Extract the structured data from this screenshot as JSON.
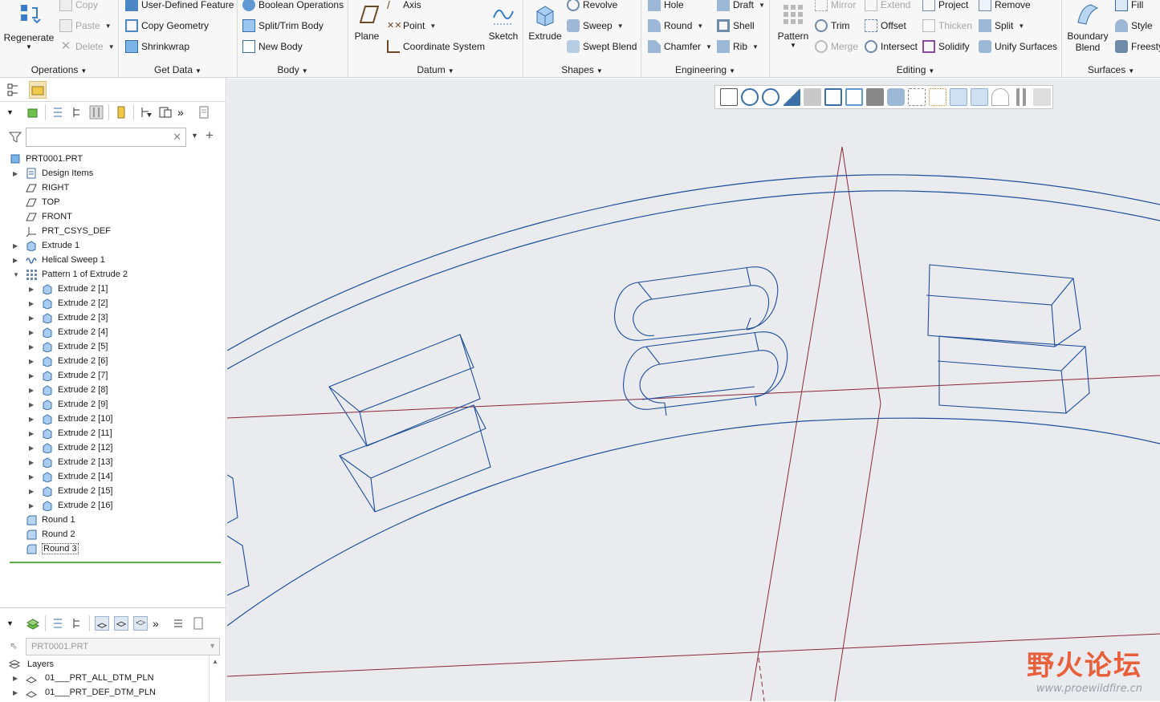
{
  "ribbon": {
    "groups": [
      {
        "title": "Operations"
      },
      {
        "title": "Get Data"
      },
      {
        "title": "Body"
      },
      {
        "title": "Datum"
      },
      {
        "title": "Shapes"
      },
      {
        "title": "Engineering"
      },
      {
        "title": "Editing"
      },
      {
        "title": "Surfaces"
      }
    ],
    "regenerate": "Regenerate",
    "copy": "Copy",
    "paste": "Paste",
    "delete": "Delete",
    "user_defined_feature": "User-Defined Feature",
    "copy_geometry": "Copy Geometry",
    "shrinkwrap": "Shrinkwrap",
    "boolean_operations": "Boolean Operations",
    "split_trim_body": "Split/Trim Body",
    "new_body": "New Body",
    "plane": "Plane",
    "axis": "Axis",
    "point": "Point",
    "coordinate_system": "Coordinate System",
    "sketch": "Sketch",
    "extrude": "Extrude",
    "revolve": "Revolve",
    "sweep": "Sweep",
    "swept_blend": "Swept Blend",
    "hole": "Hole",
    "round": "Round",
    "chamfer": "Chamfer",
    "draft": "Draft",
    "shell": "Shell",
    "rib": "Rib",
    "pattern": "Pattern",
    "mirror": "Mirror",
    "trim": "Trim",
    "merge": "Merge",
    "extend": "Extend",
    "offset": "Offset",
    "intersect": "Intersect",
    "project": "Project",
    "thicken": "Thicken",
    "solidify": "Solidify",
    "remove": "Remove",
    "split": "Split",
    "unify_surfaces": "Unify Surfaces",
    "boundary_blend_1": "Boundary",
    "boundary_blend_2": "Blend",
    "fill": "Fill",
    "style": "Style",
    "freestyle": "Freesty"
  },
  "model_tree": {
    "root": "PRT0001.PRT",
    "items": [
      {
        "label": "Design Items",
        "icon": "design-items-icon",
        "expandable": true
      },
      {
        "label": "RIGHT",
        "icon": "datum-plane-icon",
        "expandable": false
      },
      {
        "label": "TOP",
        "icon": "datum-plane-icon",
        "expandable": false
      },
      {
        "label": "FRONT",
        "icon": "datum-plane-icon",
        "expandable": false
      },
      {
        "label": "PRT_CSYS_DEF",
        "icon": "csys-icon",
        "expandable": false
      },
      {
        "label": "Extrude 1",
        "icon": "extrude-icon",
        "expandable": true
      },
      {
        "label": "Helical Sweep 1",
        "icon": "helical-sweep-icon",
        "expandable": true
      },
      {
        "label": "Pattern 1 of Extrude 2",
        "icon": "pattern-icon",
        "expandable": true,
        "expanded": true
      }
    ],
    "pattern_children": [
      "Extrude 2 [1]",
      "Extrude 2 [2]",
      "Extrude 2 [3]",
      "Extrude 2 [4]",
      "Extrude 2 [5]",
      "Extrude 2 [6]",
      "Extrude 2 [7]",
      "Extrude 2 [8]",
      "Extrude 2 [9]",
      "Extrude 2 [10]",
      "Extrude 2 [11]",
      "Extrude 2 [12]",
      "Extrude 2 [13]",
      "Extrude 2 [14]",
      "Extrude 2 [15]",
      "Extrude 2 [16]"
    ],
    "rounds": [
      "Round 1",
      "Round 2",
      "Round 3"
    ]
  },
  "layers": {
    "model": "PRT0001.PRT",
    "header": "Layers",
    "items": [
      "01___PRT_ALL_DTM_PLN",
      "01___PRT_DEF_DTM_PLN"
    ]
  },
  "watermark": {
    "title": "野火论坛",
    "url": "www.proewildfire.cn"
  },
  "colors": {
    "geometry_edge": "#1f4e9c",
    "datum_line": "#8a2a3a",
    "viewport_bg": "#eaebee"
  }
}
